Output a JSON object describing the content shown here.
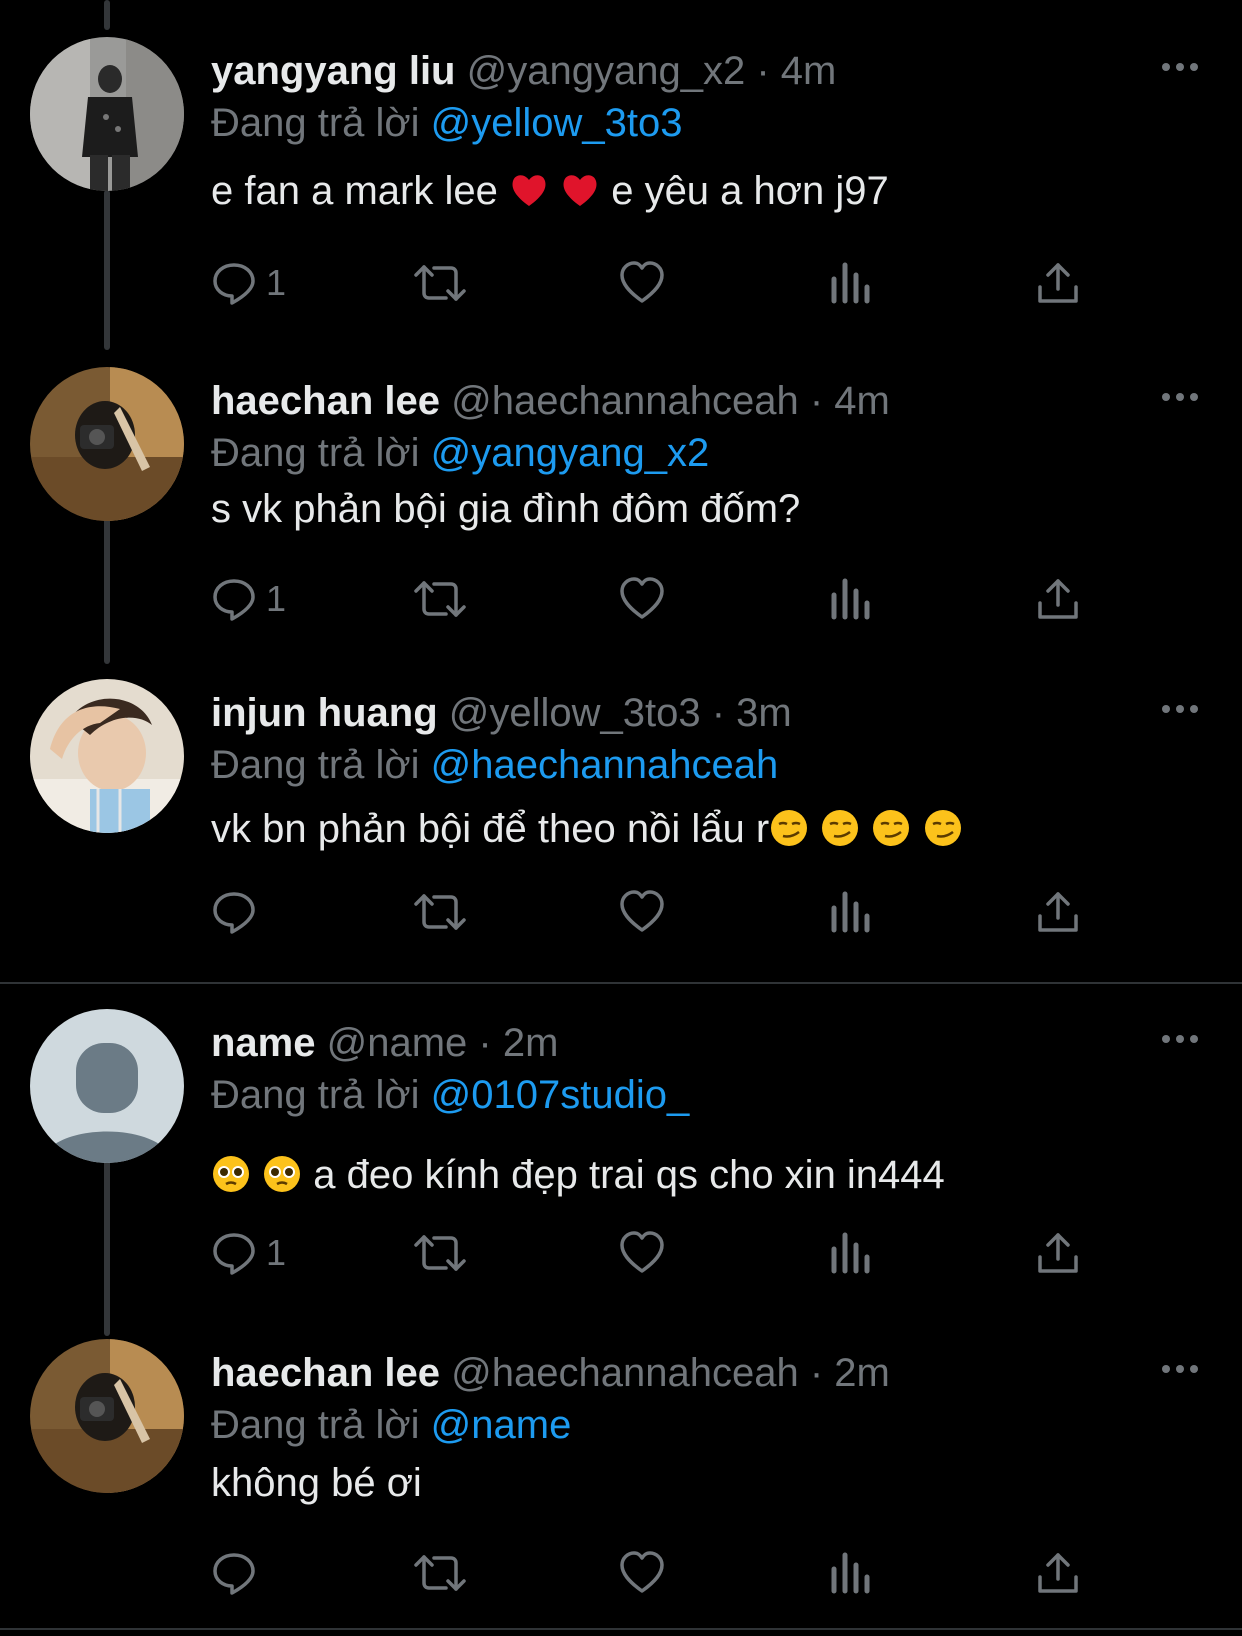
{
  "tweets": [
    {
      "name": "yangyang liu",
      "handle": "@yangyang_x2",
      "time": "· 4m",
      "reply_prefix": "Đang trả lời",
      "reply_to": "@yellow_3to3",
      "text_before": "e fan a mark lee",
      "text_after": "e yêu a hơn j97",
      "emojis": [
        "red-heart",
        "red-heart"
      ],
      "reply_count": "1"
    },
    {
      "name": "haechan lee",
      "handle": "@haechannahceah",
      "time": "· 4m",
      "reply_prefix": "Đang trả lời",
      "reply_to": "@yangyang_x2",
      "text": "s vk phản bội gia đình đôm đốm?",
      "reply_count": "1"
    },
    {
      "name": "injun huang",
      "handle": "@yellow_3to3",
      "time": "· 3m",
      "reply_prefix": "Đang trả lời",
      "reply_to": "@haechannahceah",
      "text": "vk bn phản bội để theo nồi lẩu r",
      "emojis": [
        "smirk",
        "smirk",
        "smirk",
        "smirk"
      ],
      "reply_count": ""
    },
    {
      "name": "name",
      "handle": "@name",
      "time": "· 2m",
      "reply_prefix": "Đang trả lời",
      "reply_to": "@0107studio_",
      "text": "a đeo kính đẹp trai qs cho xin in444",
      "emojis": [
        "pleading",
        "pleading"
      ],
      "reply_count": "1"
    },
    {
      "name": "haechan lee",
      "handle": "@haechannahceah",
      "time": "· 2m",
      "reply_prefix": "Đang trả lời",
      "reply_to": "@name",
      "text": "không bé ơi",
      "reply_count": ""
    }
  ],
  "icons": [
    "reply-icon",
    "retweet-icon",
    "like-icon",
    "views-icon",
    "share-icon",
    "more-icon"
  ],
  "colors": {
    "background": "#000000",
    "text": "#e7e9ea",
    "muted": "#71767b",
    "accent": "#1d9bf0",
    "divider": "#2f3336"
  }
}
